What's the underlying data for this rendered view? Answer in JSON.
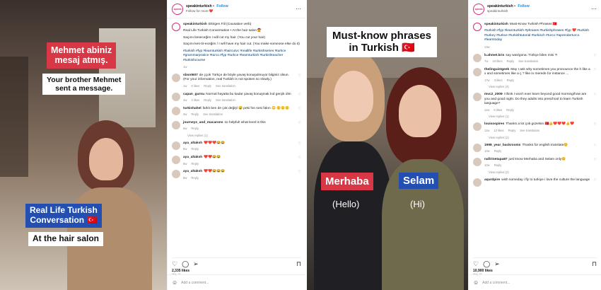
{
  "post1": {
    "video": {
      "caption_top_line1": "Mehmet abiniz",
      "caption_top_line2": "mesaj atmış.",
      "caption_translation_line1": "Your brother Mehmet",
      "caption_translation_line2": "sent a message.",
      "caption_title_line1": "Real Life Turkish",
      "caption_title_line2": "Conversation 🇹🇷",
      "caption_location": "At the hair salon"
    },
    "header": {
      "username": "speakinturkish",
      "follow": "Follow",
      "subtitle": "Follow for more ❤️"
    },
    "caption": {
      "username": "speakinturkish",
      "line1": "Ettirgen Fiil (Causative verb)",
      "line2": "Real Life Turkish Conversation • At the hair salon 💇",
      "line3": "Saçımı keseceğim I will cut my hair. (You cut your hair)",
      "line4": "Saçımı kes-tir-eceğim / I will have my hair cut. (You make someone else do it)",
      "hashtags": "#turkish #fyp #learnturkish #haircutvc #reallife #turkishseries #turkce #grammarpratice #turco #fyp #turkce #learnturkish #turkishteacher #turkishcourse",
      "age": "1w"
    },
    "comments": [
      {
        "user": "sbsnt607",
        "text": "de ççok Türkçe de böyle yavaş konuşulmuyor bilginiz olsun.(For your information, real Turkish is not spoken so slowly.)",
        "age": "1w",
        "likes": "8 likes",
        "reply": "Reply",
        "translate": "See translation"
      },
      {
        "user": "capan_gurnu",
        "text": "Normal hayatta bu kadar yavaş konuşmak kıd gerçik dim",
        "age": "4w",
        "likes": "3 likes",
        "reply": "Reply",
        "translate": "See translation"
      },
      {
        "user": "turkishahel",
        "text": "farklı ben de çok değişl 😅 peki fon sesi fakın 😳 🙂🙂🙂",
        "age": "3w",
        "likes": "",
        "reply": "Reply",
        "translate": "See translation"
      },
      {
        "user": "journeys_and_macarons",
        "text": "so helpful! what level is this",
        "age": "6w",
        "likes": "",
        "reply": "Reply",
        "translate": "",
        "replies": "View replies (1)"
      },
      {
        "user": "aya_altaksh",
        "text": "❤️❤️❤️😂😂",
        "age": "8w",
        "likes": "",
        "reply": "Reply",
        "translate": ""
      },
      {
        "user": "aya_altaksh",
        "text": "❤️❤️😂😂",
        "age": "8w",
        "likes": "",
        "reply": "Reply",
        "translate": ""
      },
      {
        "user": "aya_altaksh",
        "text": "❤️❤️😂😂😂",
        "age": "8w",
        "likes": "",
        "reply": "Reply",
        "translate": ""
      }
    ],
    "likes": "2,335 likes",
    "date": "May 15",
    "add_comment": "Add a comment..."
  },
  "post2": {
    "video": {
      "caption_title_line1": "Must-know phrases",
      "caption_title_line2": "in Turkish 🇹🇷",
      "left_word": "Merhaba",
      "left_translation": "(Hello)",
      "right_word": "Selam",
      "right_translation": "(Hi)"
    },
    "header": {
      "username": "speakinturkish",
      "follow": "Follow",
      "subtitle": "speakinturkish"
    },
    "caption": {
      "username": "speakinturkish",
      "line1": "Must-Know Turkish Phrases 🇹🇷",
      "hashtags": "#turkish #fyp #learnturkish #phrases #turkishphrases #fyp ❤️ #turkish #turkey #turkce #turkishtutorial #turkisch #turco #aprenderturco #learntoday",
      "age": "13w"
    },
    "comments": [
      {
        "user": "b.ahmet.kris",
        "text": "say was/gona: Türkçe bilen misi ?!",
        "age": "7w",
        "likes": "19 likes",
        "reply": "Reply",
        "translate": "See translation"
      },
      {
        "user": "thelinguistgeek",
        "text": "May I ask why sometimes you pronounce the h like a x and sometimes like a ç ? like in merede for instance ...",
        "age": "17w",
        "likes": "3 likes",
        "reply": "Reply",
        "translate": "",
        "replies": "View replies (4)"
      },
      {
        "user": "mvc2_2009",
        "text": "I think I won't ever learn beyond good morning/how are you and good night. Do they adults into preschool to learn Turkish language?",
        "age": "11w",
        "likes": "6 likes",
        "reply": "Reply",
        "translate": "",
        "replies": "View replies (1)"
      },
      {
        "user": "louisospires",
        "text": "Thanks a lot çok güzelsin 🇹🇷👍❤️❤️❤️👍❤️",
        "age": "11w",
        "likes": "12 likes",
        "reply": "Reply",
        "translate": "See translation",
        "replies": "View replies (2)"
      },
      {
        "user": "1998_year_backrooms",
        "text": "Thanks for english translate😊",
        "age": "10w",
        "likes": "",
        "reply": "Reply",
        "translate": ""
      },
      {
        "user": "nafirinetapa87",
        "text": "just know Merhaba and Selam only😊",
        "age": "10w",
        "likes": "",
        "reply": "Reply",
        "translate": "",
        "replies": "View replies (2)"
      },
      {
        "user": "aqurdpire",
        "text": "wish someday i fly to turkiye i love the culture the language",
        "age": "",
        "likes": "",
        "reply": "",
        "translate": ""
      }
    ],
    "likes": "10,900 likes",
    "date": "May 15",
    "add_comment": "Add a comment..."
  },
  "icons": {
    "heart": "heart-icon",
    "comment": "comment-icon",
    "share": "share-icon",
    "save": "bookmark-icon",
    "emoji": "emoji-icon",
    "more": "more-icon"
  },
  "colors": {
    "caption_red": "#d83846",
    "caption_blue": "#234fb3",
    "follow_blue": "#0095f6",
    "brand_ring": "#d62976"
  }
}
